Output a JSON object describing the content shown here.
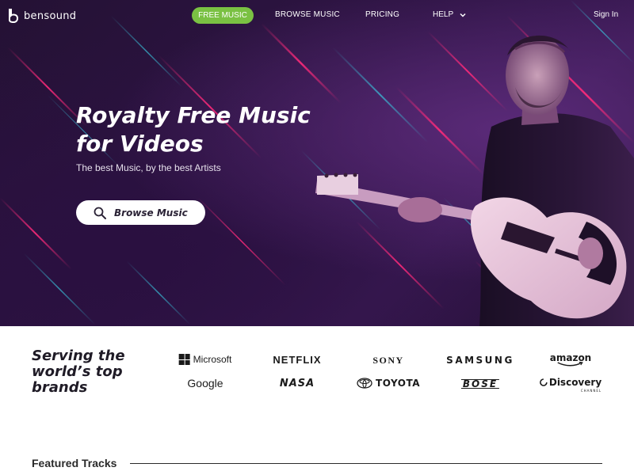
{
  "nav": {
    "logo_text": "bensound",
    "items": [
      {
        "label": "FREE MUSIC",
        "active": true
      },
      {
        "label": "BROWSE MUSIC"
      },
      {
        "label": "PRICING"
      },
      {
        "label": "HELP"
      }
    ],
    "signin_label": "Sign In",
    "accent_color": "#7ac143"
  },
  "hero": {
    "title_line1": "Royalty Free Music",
    "title_line2": "for Videos",
    "subtitle": "The best Music, by the best Artists",
    "browse_button": {
      "label": "Browse Music",
      "icon": "search-icon"
    },
    "background_color": "#2e1444"
  },
  "brands": {
    "title_line1": "Serving the",
    "title_line2": "world’s top",
    "title_line3": "brands",
    "items": [
      "Microsoft",
      "NETFLIX",
      "SONY",
      "SAMSUNG",
      "amazon",
      "Google",
      "NASA",
      "TOYOTA",
      "BOSE",
      "Discovery"
    ],
    "discovery_sub": "CHANNEL"
  },
  "featured": {
    "title": "Featured Tracks"
  }
}
